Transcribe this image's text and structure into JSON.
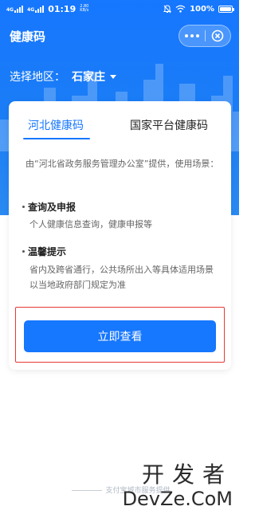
{
  "status_bar": {
    "signal1": "4G",
    "signal2": "4G",
    "time": "01:19",
    "speed_value": "2.80",
    "speed_unit": "KB/s",
    "battery": "100%"
  },
  "titlebar": {
    "title": "健康码"
  },
  "region": {
    "label": "选择地区：",
    "city": "石家庄"
  },
  "tabs": [
    {
      "label": "河北健康码",
      "active": true
    },
    {
      "label": "国家平台健康码",
      "active": false
    }
  ],
  "card": {
    "description": "由“河北省政务服务管理办公室”提供，使用场景：",
    "section1_title": "查询及申报",
    "section1_body": "个人健康信息查询，健康申报等",
    "section2_title": "温馨提示",
    "section2_body": "省内及跨省通行，公共场所出入等具体适用场景以当地政府部门规定为准",
    "button_label": "立即查看"
  },
  "footer": {
    "provider": "支付宝城市服务提供"
  },
  "watermark": {
    "cn": "开发者",
    "en": "DevZe.CoM"
  },
  "colors": {
    "primary": "#1677ff",
    "highlight": "#e53935"
  },
  "icons": [
    "wifi-icon",
    "mute-bell-icon",
    "more-dots-icon",
    "close-circle-icon",
    "caret-down-icon"
  ]
}
